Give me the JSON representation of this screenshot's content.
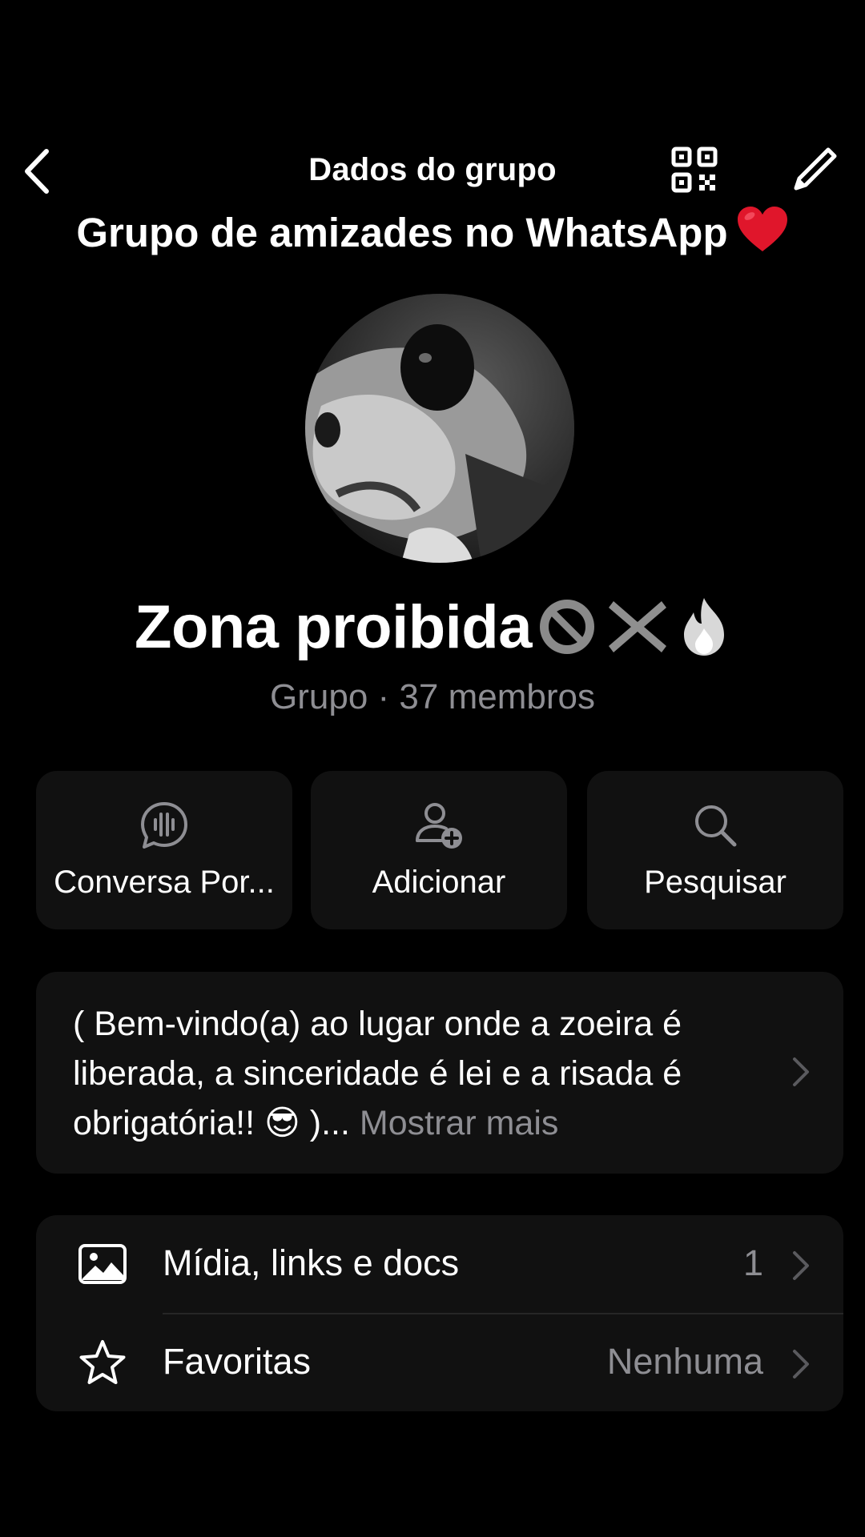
{
  "header": {
    "title": "Dados do grupo",
    "back_icon": "chevron-left-icon",
    "qr_icon": "qr-code-icon",
    "edit_icon": "pencil-icon"
  },
  "overlay_caption": "Grupo de amizades no WhatsApp",
  "group": {
    "name": "Zona proibida",
    "name_emojis": [
      "no-entry-sign-emoji",
      "cross-mark-emoji",
      "fire-emoji"
    ],
    "subtitle": "Grupo · 37 membros"
  },
  "actions": [
    {
      "label": "Conversa Por...",
      "icon": "voice-chat-icon"
    },
    {
      "label": "Adicionar",
      "icon": "add-person-icon"
    },
    {
      "label": "Pesquisar",
      "icon": "search-icon"
    }
  ],
  "description": {
    "text": "( Bem-vindo(a) ao lugar onde a zoeira é liberada, a sinceridade é lei e a risada é obrigatória!! 😎 )...",
    "more": "Mostrar mais"
  },
  "list": [
    {
      "label": "Mídia, links e docs",
      "value": "1",
      "icon": "image-icon"
    },
    {
      "label": "Favoritas",
      "value": "Nenhuma",
      "icon": "star-icon"
    }
  ],
  "colors": {
    "background": "#000000",
    "card": "#111111",
    "secondary_text": "#8e8e93",
    "heart": "#e0162b"
  }
}
